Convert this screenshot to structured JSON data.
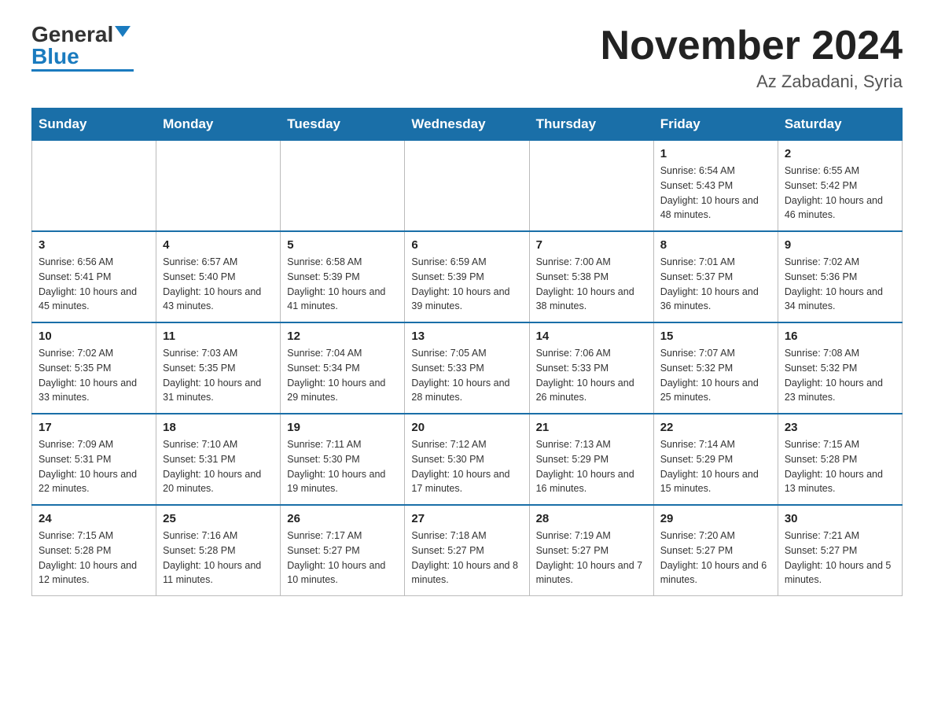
{
  "header": {
    "logo_general": "General",
    "logo_blue": "Blue",
    "month_title": "November 2024",
    "location": "Az Zabadani, Syria"
  },
  "weekdays": [
    "Sunday",
    "Monday",
    "Tuesday",
    "Wednesday",
    "Thursday",
    "Friday",
    "Saturday"
  ],
  "weeks": [
    [
      {
        "day": "",
        "info": ""
      },
      {
        "day": "",
        "info": ""
      },
      {
        "day": "",
        "info": ""
      },
      {
        "day": "",
        "info": ""
      },
      {
        "day": "",
        "info": ""
      },
      {
        "day": "1",
        "info": "Sunrise: 6:54 AM\nSunset: 5:43 PM\nDaylight: 10 hours and 48 minutes."
      },
      {
        "day": "2",
        "info": "Sunrise: 6:55 AM\nSunset: 5:42 PM\nDaylight: 10 hours and 46 minutes."
      }
    ],
    [
      {
        "day": "3",
        "info": "Sunrise: 6:56 AM\nSunset: 5:41 PM\nDaylight: 10 hours and 45 minutes."
      },
      {
        "day": "4",
        "info": "Sunrise: 6:57 AM\nSunset: 5:40 PM\nDaylight: 10 hours and 43 minutes."
      },
      {
        "day": "5",
        "info": "Sunrise: 6:58 AM\nSunset: 5:39 PM\nDaylight: 10 hours and 41 minutes."
      },
      {
        "day": "6",
        "info": "Sunrise: 6:59 AM\nSunset: 5:39 PM\nDaylight: 10 hours and 39 minutes."
      },
      {
        "day": "7",
        "info": "Sunrise: 7:00 AM\nSunset: 5:38 PM\nDaylight: 10 hours and 38 minutes."
      },
      {
        "day": "8",
        "info": "Sunrise: 7:01 AM\nSunset: 5:37 PM\nDaylight: 10 hours and 36 minutes."
      },
      {
        "day": "9",
        "info": "Sunrise: 7:02 AM\nSunset: 5:36 PM\nDaylight: 10 hours and 34 minutes."
      }
    ],
    [
      {
        "day": "10",
        "info": "Sunrise: 7:02 AM\nSunset: 5:35 PM\nDaylight: 10 hours and 33 minutes."
      },
      {
        "day": "11",
        "info": "Sunrise: 7:03 AM\nSunset: 5:35 PM\nDaylight: 10 hours and 31 minutes."
      },
      {
        "day": "12",
        "info": "Sunrise: 7:04 AM\nSunset: 5:34 PM\nDaylight: 10 hours and 29 minutes."
      },
      {
        "day": "13",
        "info": "Sunrise: 7:05 AM\nSunset: 5:33 PM\nDaylight: 10 hours and 28 minutes."
      },
      {
        "day": "14",
        "info": "Sunrise: 7:06 AM\nSunset: 5:33 PM\nDaylight: 10 hours and 26 minutes."
      },
      {
        "day": "15",
        "info": "Sunrise: 7:07 AM\nSunset: 5:32 PM\nDaylight: 10 hours and 25 minutes."
      },
      {
        "day": "16",
        "info": "Sunrise: 7:08 AM\nSunset: 5:32 PM\nDaylight: 10 hours and 23 minutes."
      }
    ],
    [
      {
        "day": "17",
        "info": "Sunrise: 7:09 AM\nSunset: 5:31 PM\nDaylight: 10 hours and 22 minutes."
      },
      {
        "day": "18",
        "info": "Sunrise: 7:10 AM\nSunset: 5:31 PM\nDaylight: 10 hours and 20 minutes."
      },
      {
        "day": "19",
        "info": "Sunrise: 7:11 AM\nSunset: 5:30 PM\nDaylight: 10 hours and 19 minutes."
      },
      {
        "day": "20",
        "info": "Sunrise: 7:12 AM\nSunset: 5:30 PM\nDaylight: 10 hours and 17 minutes."
      },
      {
        "day": "21",
        "info": "Sunrise: 7:13 AM\nSunset: 5:29 PM\nDaylight: 10 hours and 16 minutes."
      },
      {
        "day": "22",
        "info": "Sunrise: 7:14 AM\nSunset: 5:29 PM\nDaylight: 10 hours and 15 minutes."
      },
      {
        "day": "23",
        "info": "Sunrise: 7:15 AM\nSunset: 5:28 PM\nDaylight: 10 hours and 13 minutes."
      }
    ],
    [
      {
        "day": "24",
        "info": "Sunrise: 7:15 AM\nSunset: 5:28 PM\nDaylight: 10 hours and 12 minutes."
      },
      {
        "day": "25",
        "info": "Sunrise: 7:16 AM\nSunset: 5:28 PM\nDaylight: 10 hours and 11 minutes."
      },
      {
        "day": "26",
        "info": "Sunrise: 7:17 AM\nSunset: 5:27 PM\nDaylight: 10 hours and 10 minutes."
      },
      {
        "day": "27",
        "info": "Sunrise: 7:18 AM\nSunset: 5:27 PM\nDaylight: 10 hours and 8 minutes."
      },
      {
        "day": "28",
        "info": "Sunrise: 7:19 AM\nSunset: 5:27 PM\nDaylight: 10 hours and 7 minutes."
      },
      {
        "day": "29",
        "info": "Sunrise: 7:20 AM\nSunset: 5:27 PM\nDaylight: 10 hours and 6 minutes."
      },
      {
        "day": "30",
        "info": "Sunrise: 7:21 AM\nSunset: 5:27 PM\nDaylight: 10 hours and 5 minutes."
      }
    ]
  ]
}
